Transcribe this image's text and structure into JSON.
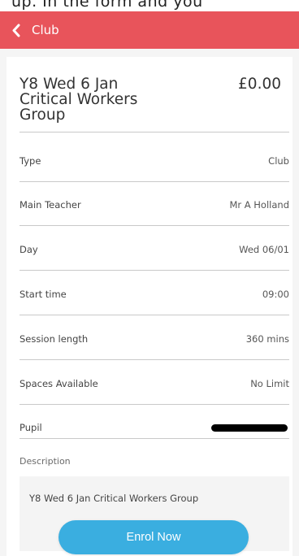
{
  "top_text": "up. In the form and you",
  "header": {
    "title": "Club"
  },
  "club": {
    "title": "Y8 Wed 6 Jan Critical Workers Group",
    "price": "£0.00"
  },
  "details": [
    {
      "label": "Type",
      "value": "Club"
    },
    {
      "label": "Main Teacher",
      "value": "Mr A Holland"
    },
    {
      "label": "Day",
      "value": "Wed 06/01"
    },
    {
      "label": "Start time",
      "value": "09:00"
    },
    {
      "label": "Session length",
      "value": "360 mins"
    },
    {
      "label": "Spaces Available",
      "value": "No Limit"
    }
  ],
  "pupil": {
    "label": "Pupil"
  },
  "description": {
    "label": "Description",
    "text": "Y8 Wed 6 Jan Critical Workers Group"
  },
  "enrol_button": {
    "label": "Enrol Now"
  },
  "colors": {
    "header_bg": "#e8545b",
    "button_bg": "#3aaee0",
    "page_bg": "#f5f5f5"
  },
  "icons": {
    "back": "chevron-left-icon",
    "redaction": "redaction-bar"
  }
}
